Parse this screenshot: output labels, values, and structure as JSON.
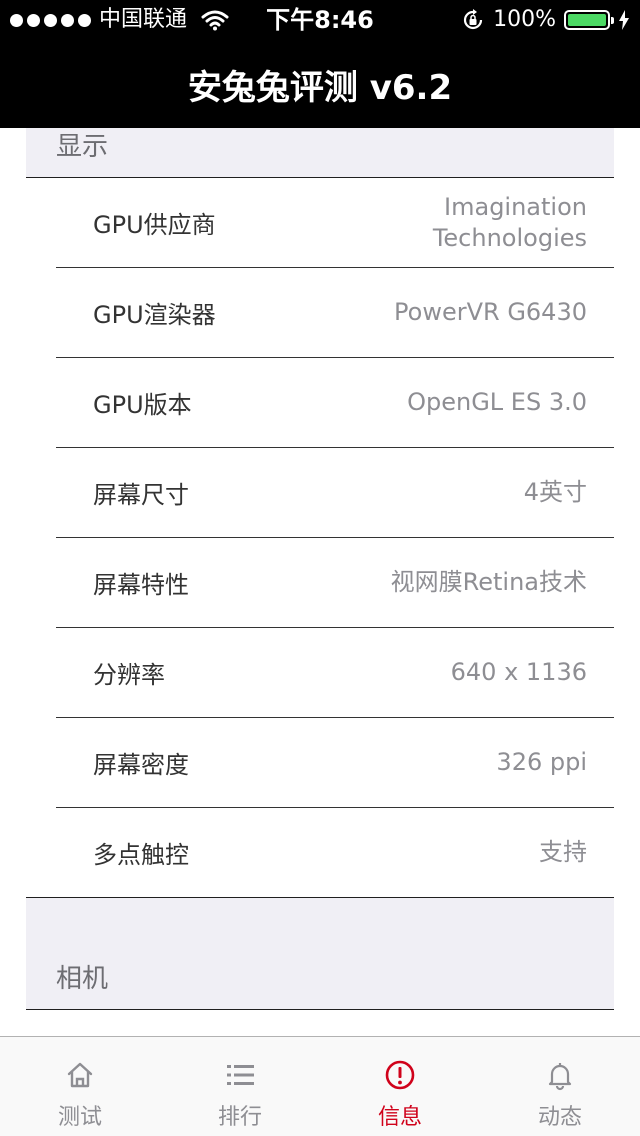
{
  "status_bar": {
    "carrier": "中国联通",
    "time": "下午8:46",
    "battery": "100%",
    "battery_color": "#4cd964",
    "icons": [
      "signal-dots",
      "wifi-icon",
      "orientation-lock-icon",
      "battery-icon",
      "charging-bolt-icon"
    ]
  },
  "nav": {
    "title": "安兔兔评测 v6.2"
  },
  "display_section": {
    "header": "显示",
    "rows": [
      {
        "key": "GPU供应商",
        "value": "Imagination Technologies"
      },
      {
        "key": "GPU渲染器",
        "value": "PowerVR G6430"
      },
      {
        "key": "GPU版本",
        "value": "OpenGL ES 3.0"
      },
      {
        "key": "屏幕尺寸",
        "value": "4英寸"
      },
      {
        "key": "屏幕特性",
        "value": "视网膜Retina技术"
      },
      {
        "key": "分辨率",
        "value": "640 x 1136"
      },
      {
        "key": "屏幕密度",
        "value": "326 ppi"
      },
      {
        "key": "多点触控",
        "value": "支持"
      }
    ]
  },
  "camera_section": {
    "header": "相机"
  },
  "tabbar": {
    "active_color": "#d0021b",
    "tabs": [
      {
        "label": "测试",
        "icon": "home-icon",
        "active": false
      },
      {
        "label": "排行",
        "icon": "list-icon",
        "active": false
      },
      {
        "label": "信息",
        "icon": "info-alert-icon",
        "active": true
      },
      {
        "label": "动态",
        "icon": "bell-icon",
        "active": false
      }
    ]
  }
}
